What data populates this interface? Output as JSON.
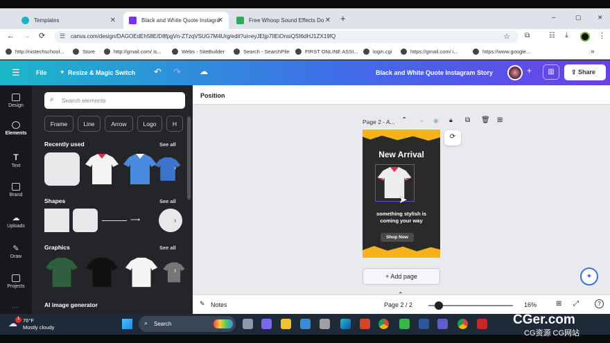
{
  "browser": {
    "tabs": [
      {
        "title": "Templates",
        "active": false
      },
      {
        "title": "Black and White Quote Instagra",
        "active": true
      },
      {
        "title": "Free Whoop Sound Effects Do",
        "active": false
      }
    ],
    "new_tab": "+",
    "url": "canva.com/design/DAGOEdEh58E/D8fpgVn-ZTzqVSUG7M4Urg/edit?ui=eyJEljp7IlEiOnsiQSI6dHJ1ZX19fQ",
    "bookmarks": [
      "http://nistechschool...",
      "Store",
      "http://gmail.com/ is...",
      "Webs - SiteBuilder",
      "Search - SearchPile",
      "FIRST ONLINE ASSI...",
      "login.cgi",
      "https://gmail.com/ i...",
      "https://www.google..."
    ],
    "window_controls": {
      "minimize": "–",
      "maximize": "▢",
      "close": "✕"
    }
  },
  "canva": {
    "menu_icon": "hamburger-icon",
    "file_label": "File",
    "resize_label": "Resize & Magic Switch",
    "design_title": "Black and White Quote Instagram Story",
    "share_label": "Share",
    "avatar_plus": "+"
  },
  "rail": [
    {
      "label": "Design"
    },
    {
      "label": "Elements"
    },
    {
      "label": "Text"
    },
    {
      "label": "Brand"
    },
    {
      "label": "Uploads"
    },
    {
      "label": "Draw"
    },
    {
      "label": "Projects"
    }
  ],
  "panel": {
    "search_placeholder": "Search elements",
    "chips": [
      "Frame",
      "Line",
      "Arrow",
      "Logo",
      "H"
    ],
    "recently_used": "Recently used",
    "shapes": "Shapes",
    "graphics": "Graphics",
    "ai_generator": "AI image generator",
    "see_all": "See all"
  },
  "workspace": {
    "position_label": "Position",
    "page_label": "Page 2 - A...",
    "design": {
      "headline": "New Arrival",
      "tagline_1": "something stylish is",
      "tagline_2": "coming your way",
      "button": "Shop Now"
    },
    "add_page": "+ Add page",
    "notes_label": "Notes",
    "page_counter": "Page 2 / 2",
    "zoom": "16%",
    "zoom_fraction": 0.07
  },
  "taskbar": {
    "temperature": "76°F",
    "weather": "Mostly cloudy",
    "weather_badge": "1",
    "search_label": "Search"
  },
  "watermark": {
    "main": "CGer.com",
    "sub": "CG资源 CG网站"
  },
  "colors": {
    "accent_teal": "#1bb7c9",
    "accent_purple": "#6b3fe8",
    "design_yellow": "#f5b21b",
    "panel_bg": "#242528",
    "shirt_collar": "#d6334e"
  }
}
